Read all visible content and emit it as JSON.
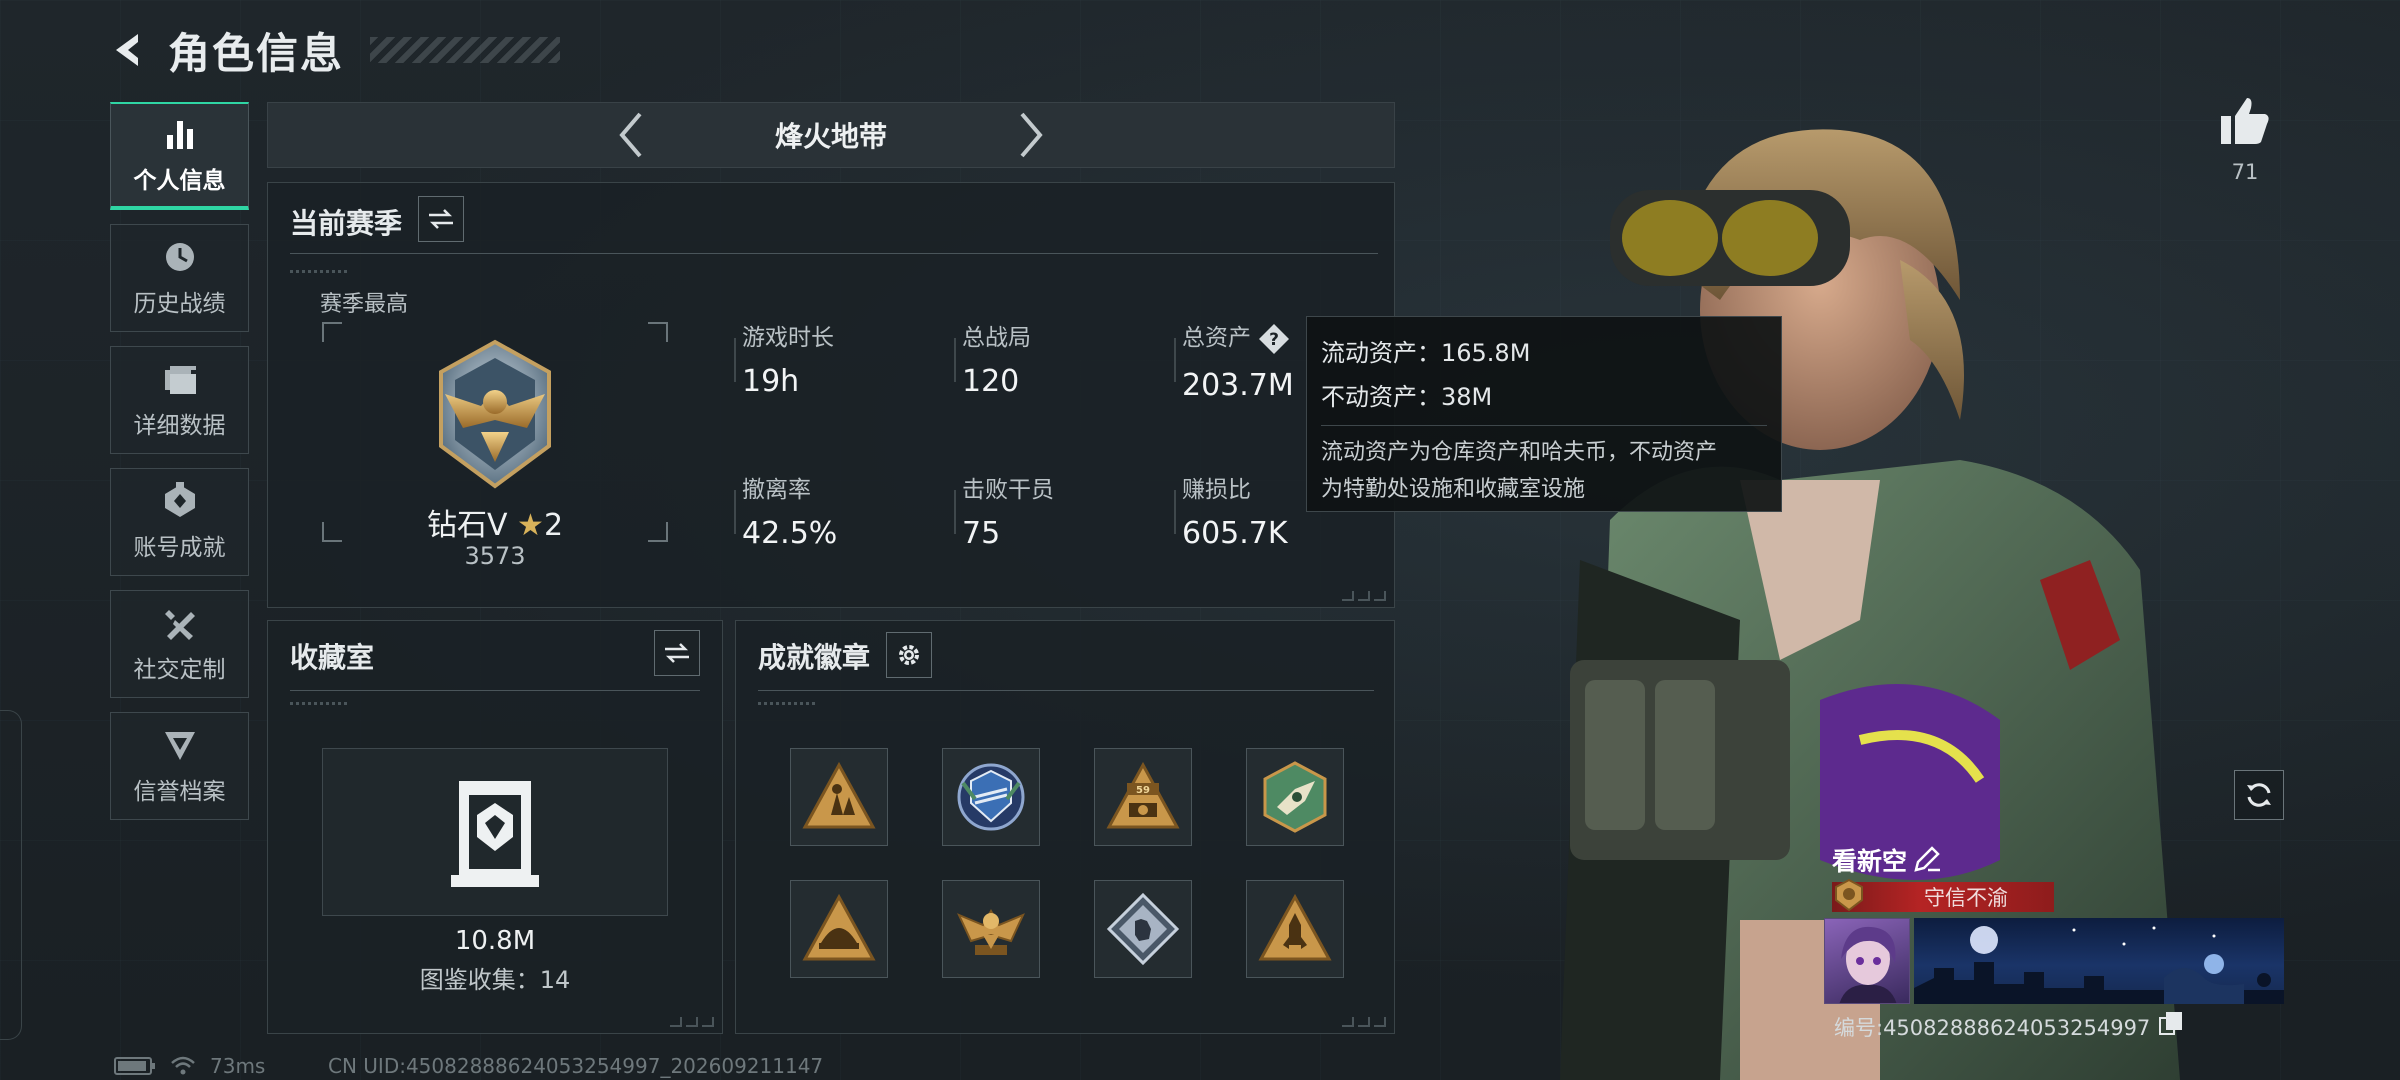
{
  "header": {
    "title": "角色信息"
  },
  "sidebar": {
    "items": [
      {
        "label": "个人信息",
        "active": true,
        "icon": "bar-chart-icon"
      },
      {
        "label": "历史战绩",
        "active": false,
        "icon": "clock-history-icon"
      },
      {
        "label": "详细数据",
        "active": false,
        "icon": "folder-icon"
      },
      {
        "label": "账号成就",
        "active": false,
        "icon": "achievement-icon"
      },
      {
        "label": "社交定制",
        "active": false,
        "icon": "wrench-screwdriver-icon"
      },
      {
        "label": "信誉档案",
        "active": false,
        "icon": "credit-shield-icon"
      }
    ]
  },
  "mode": {
    "title": "烽火地带"
  },
  "season": {
    "title": "当前赛季",
    "best_label": "赛季最高",
    "rank_name": "钻石V",
    "rank_stars": "2",
    "rank_score": "3573",
    "stats": [
      {
        "label": "游戏时长",
        "value": "19h"
      },
      {
        "label": "总战局",
        "value": "120"
      },
      {
        "label": "总资产",
        "value": "203.7M"
      },
      {
        "label": "撤离率",
        "value": "42.5%"
      },
      {
        "label": "击败干员",
        "value": "75"
      },
      {
        "label": "赚损比",
        "value": "605.7K"
      }
    ]
  },
  "tooltip": {
    "liquid": "流动资产：165.8M",
    "fixed": "不动资产：38M",
    "desc1": "流动资产为仓库资产和哈夫币，不动资产",
    "desc2": "为特勤处设施和收藏室设施"
  },
  "collection": {
    "title": "收藏室",
    "value": "10.8M",
    "count": "图鉴收集：14"
  },
  "badges": {
    "title": "成就徽章",
    "items": [
      {
        "icon": "triangle-soldiers-badge-icon",
        "color": "#c9974a"
      },
      {
        "icon": "blue-shield-badge-icon",
        "color": "#3b6fb5"
      },
      {
        "icon": "triangle-59-badge-icon",
        "color": "#c9974a"
      },
      {
        "icon": "green-hexagon-badge-icon",
        "color": "#4e8a63"
      },
      {
        "icon": "triangle-helmet-badge-icon",
        "color": "#c9974a"
      },
      {
        "icon": "eagle-badge-icon",
        "color": "#c9974a"
      },
      {
        "icon": "diamond-hand-badge-icon",
        "color": "#a8b4c4"
      },
      {
        "icon": "triangle-rocket-badge-icon",
        "color": "#c9974a"
      }
    ]
  },
  "profile": {
    "likes": "71",
    "name": "看新空",
    "title": "守信不渝",
    "player_id": "编号:4508288862405325499​7"
  },
  "status": {
    "ping": "73ms",
    "uid": "CN UID:4508288862405325499​7_202609211147"
  },
  "colors": {
    "accent": "#2fd6a4",
    "title_red": "#b52424"
  }
}
